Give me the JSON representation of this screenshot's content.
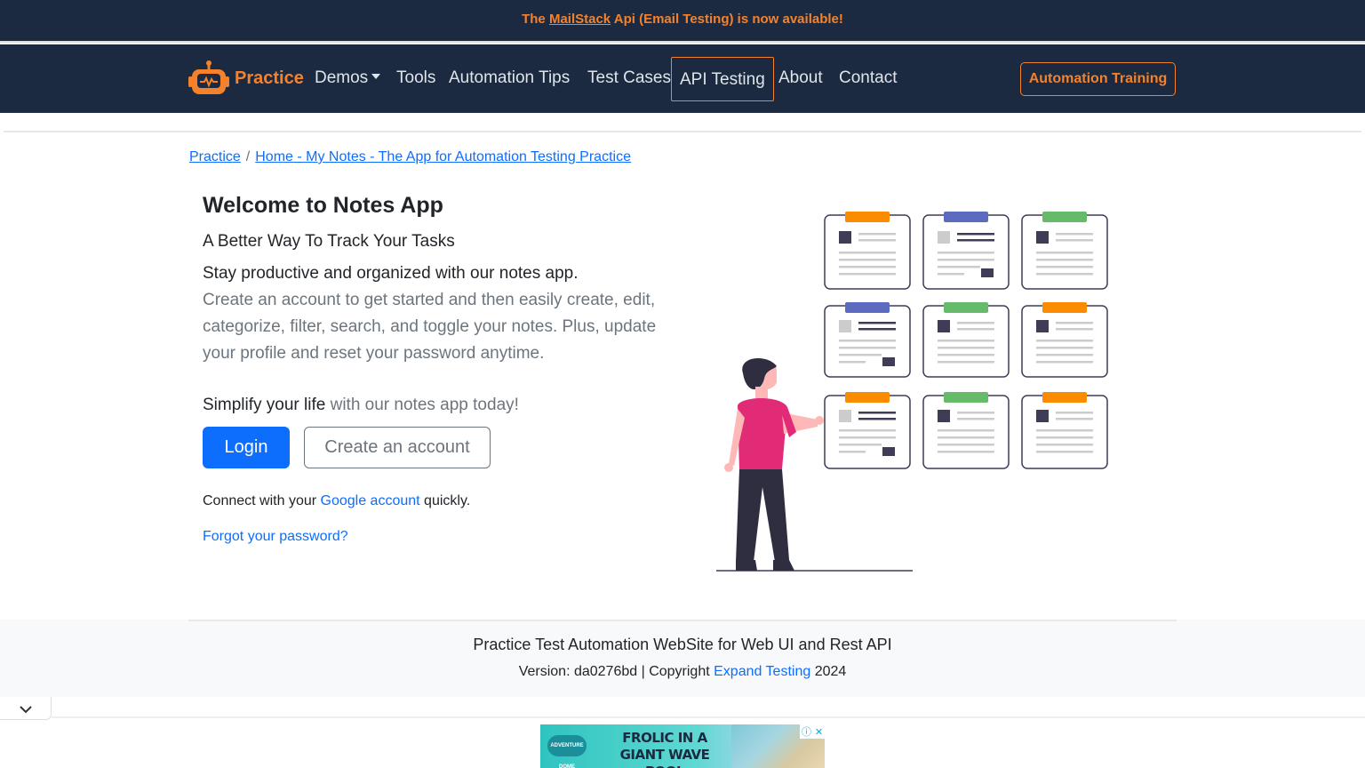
{
  "announcement": {
    "prefix": "The ",
    "link": "MailStack",
    "suffix": " Api (Email Testing) is now available!"
  },
  "nav": {
    "brand": "Practice",
    "items": [
      "Demos",
      "Tools",
      "Automation Tips",
      "Test Cases",
      "API Testing",
      "About",
      "Contact"
    ],
    "active": "API Testing",
    "cta": "Automation Training"
  },
  "breadcrumb": {
    "root": "Practice",
    "separator": "/",
    "current": "Home - My Notes - The App for Automation Testing Practice"
  },
  "hero": {
    "title": "Welcome to Notes App",
    "subtitle": "A Better Way To Track Your Tasks",
    "lead": "Stay productive and organized with our notes app.",
    "description": "Create an account to get started and then easily create, edit, categorize, filter, search, and toggle your notes. Plus, update your profile and reset your password anytime.",
    "simplify_dark": "Simplify your life",
    "simplify_rest": " with our notes app today!",
    "login_label": "Login",
    "create_label": "Create an account",
    "google_prefix": "Connect with your ",
    "google_link": "Google account",
    "google_suffix": " quickly.",
    "forgot_label": "Forgot your password?"
  },
  "footer": {
    "title": "Practice Test Automation WebSite for Web UI and Rest API",
    "version_prefix": "Version: da0276bd | Copyright ",
    "company": "Expand Testing",
    "year": " 2024"
  },
  "ad": {
    "logo_text": "ADVENTURE DOME",
    "line1": "FROLIC IN A",
    "line2": "GIANT WAVE POOL"
  },
  "colors": {
    "navy": "#1b2a40",
    "orange": "#f5822a",
    "primary": "#0d6efd",
    "card_tabs": [
      "#fb8c00",
      "#5c6bc0",
      "#66bb6a"
    ]
  },
  "icons": {
    "brand": "robot-logo-icon",
    "collapse": "chevron-down-icon",
    "ad_info": "info-icon",
    "ad_close": "close-icon"
  }
}
